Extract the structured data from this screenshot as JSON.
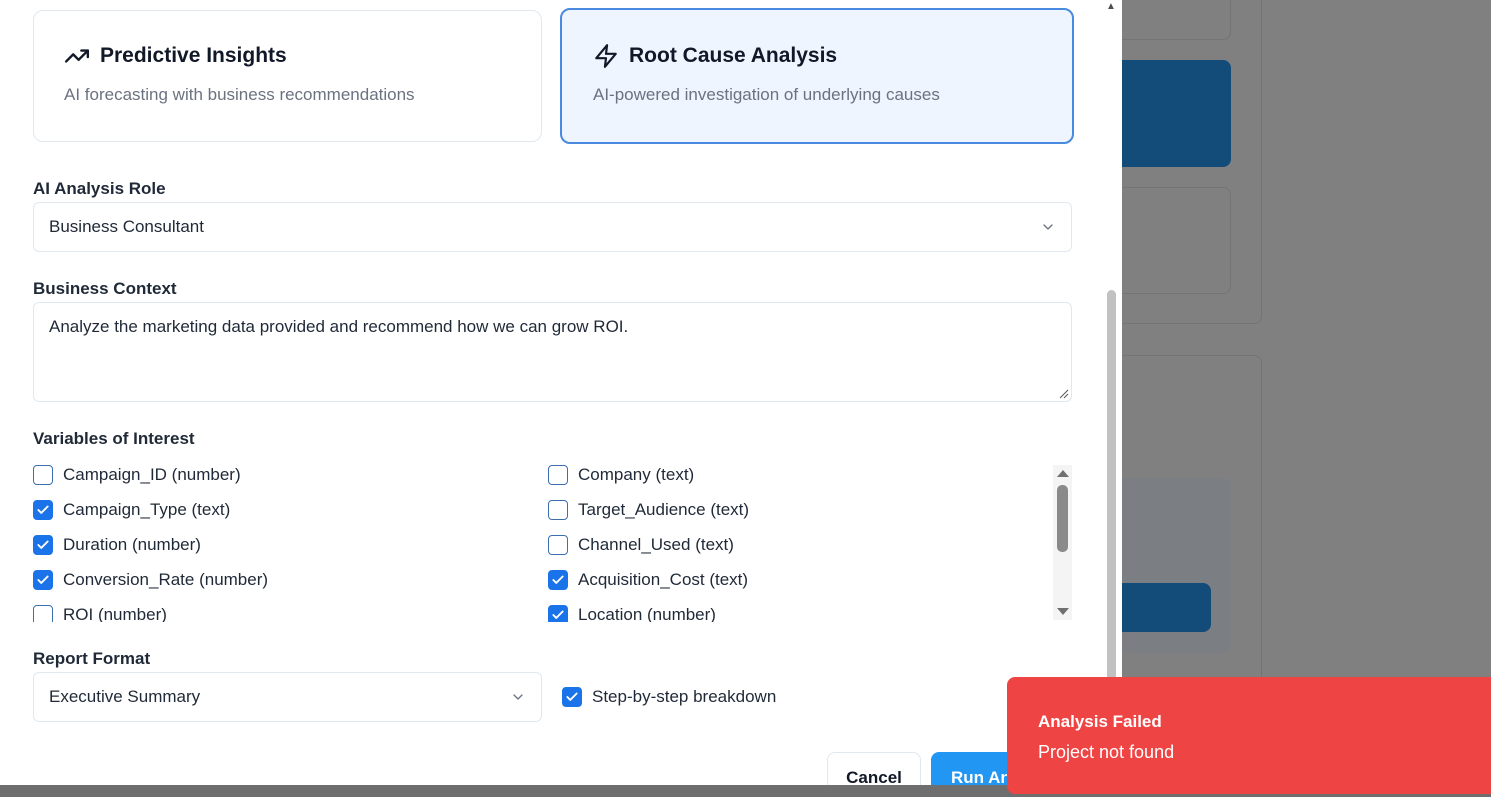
{
  "analysis_types": [
    {
      "title": "Predictive Insights",
      "description": "AI forecasting with business recommendations",
      "icon": "trending-up-icon",
      "selected": false
    },
    {
      "title": "Root Cause Analysis",
      "description": "AI-powered investigation of underlying causes",
      "icon": "lightning-icon",
      "selected": true
    }
  ],
  "role": {
    "label": "AI Analysis Role",
    "value": "Business Consultant"
  },
  "context": {
    "label": "Business Context",
    "value": "Analyze the marketing data provided and recommend how we can grow ROI."
  },
  "variables": {
    "label": "Variables of Interest",
    "items": [
      {
        "label": "Campaign_ID (number)",
        "checked": false
      },
      {
        "label": "Company (text)",
        "checked": false
      },
      {
        "label": "Campaign_Type (text)",
        "checked": true
      },
      {
        "label": "Target_Audience (text)",
        "checked": false
      },
      {
        "label": "Duration (number)",
        "checked": true
      },
      {
        "label": "Channel_Used (text)",
        "checked": false
      },
      {
        "label": "Conversion_Rate (number)",
        "checked": true
      },
      {
        "label": "Acquisition_Cost (text)",
        "checked": true
      },
      {
        "label": "ROI (number)",
        "checked": false
      },
      {
        "label": "Location (number)",
        "checked": true
      }
    ]
  },
  "report_format": {
    "label": "Report Format",
    "value": "Executive Summary"
  },
  "step_by_step": {
    "label": "Step-by-step breakdown",
    "checked": true
  },
  "buttons": {
    "cancel": "Cancel",
    "run": "Run Analysis"
  },
  "toast": {
    "title": "Analysis Failed",
    "message": "Project not found"
  },
  "colors": {
    "accent": "#1a73e8",
    "selected_border": "#4a89e0",
    "run_button": "#2196f3",
    "toast_bg": "#ef4444"
  }
}
